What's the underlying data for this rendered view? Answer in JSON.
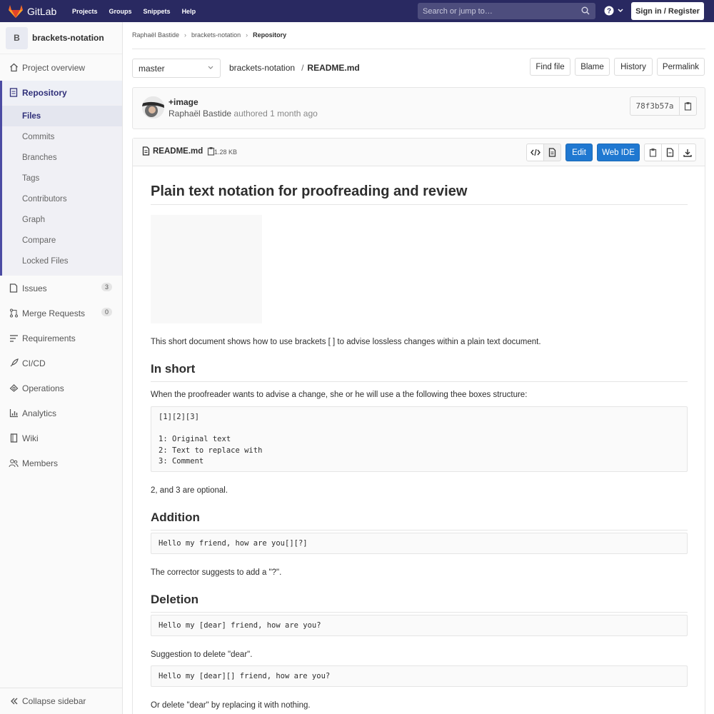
{
  "topbar": {
    "brand": "GitLab",
    "nav": [
      "Projects",
      "Groups",
      "Snippets",
      "Help"
    ],
    "search_placeholder": "Search or jump to…",
    "signin": "Sign in / Register"
  },
  "sidebar": {
    "project_initial": "B",
    "project_name": "brackets-notation",
    "overview": "Project overview",
    "repository": "Repository",
    "repo_items": [
      "Files",
      "Commits",
      "Branches",
      "Tags",
      "Contributors",
      "Graph",
      "Compare",
      "Locked Files"
    ],
    "issues": "Issues",
    "issues_count": "3",
    "merge_requests": "Merge Requests",
    "mr_count": "0",
    "requirements": "Requirements",
    "cicd": "CI/CD",
    "operations": "Operations",
    "analytics": "Analytics",
    "wiki": "Wiki",
    "members": "Members",
    "collapse": "Collapse sidebar"
  },
  "breadcrumb": {
    "owner": "Raphaël Bastide",
    "project": "brackets-notation",
    "current": "Repository"
  },
  "toolbar": {
    "branch": "master",
    "path_root": "brackets-notation",
    "path_sep": "/",
    "path_file": "README.md",
    "find_file": "Find file",
    "blame": "Blame",
    "history": "History",
    "permalink": "Permalink"
  },
  "commit": {
    "title": "+image",
    "author": "Raphaël Bastide",
    "meta": "authored 1 month ago",
    "sha": "78f3b57a"
  },
  "file": {
    "name": "README.md",
    "size": "1.28 KB",
    "edit": "Edit",
    "web_ide": "Web IDE"
  },
  "readme": {
    "h1": "Plain text notation for proofreading and review",
    "intro": "This short document shows how to use brackets [ ] to advise lossless changes within a plain text document.",
    "h2_short": "In short",
    "short_p": "When the proofreader wants to advise a change, she or he will use a the following thee boxes structure:",
    "short_code": "[1][2][3]\n\n1: Original text\n2: Text to replace with\n3: Comment",
    "optional": "2, and 3 are optional.",
    "h2_addition": "Addition",
    "addition_code": "Hello my friend, how are you[][?]",
    "addition_p": "The corrector suggests to add a \"?\".",
    "h2_deletion": "Deletion",
    "deletion_code1": "Hello my [dear] friend, how are you?",
    "deletion_p1": "Suggestion to delete \"dear\".",
    "deletion_code2": "Hello my [dear][] friend, how are you?",
    "deletion_p2": "Or delete \"dear\" by replacing it with nothing."
  },
  "colors": {
    "topbar": "#292961",
    "accent": "#4b4ba3",
    "primary_button": "#1f78d1",
    "logo_orange": "#fc6d26"
  }
}
